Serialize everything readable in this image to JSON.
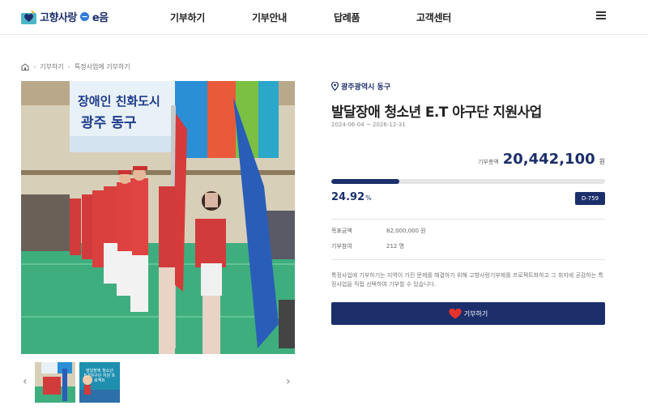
{
  "header": {
    "logo_text": "고향사랑",
    "logo_suffix": "e음",
    "nav": [
      "기부하기",
      "기부안내",
      "답례품",
      "고객센터"
    ]
  },
  "breadcrumb": [
    "기부하기",
    "특정사업에 기부하기"
  ],
  "photo": {
    "banner_line1": "장애인 친화도시",
    "banner_line2": "광주 동구"
  },
  "thumbnails": {
    "thumb2_text": "발달장애 청소년 E.T야구단 지원 프로젝트"
  },
  "project": {
    "region": "광주광역시 동구",
    "title": "발달장애 청소년 E.T 야구단 지원사업",
    "period": "2024-06-04 ~ 2026-12-31",
    "donate_total_label": "기부총액",
    "donate_total_value": "20,442,100",
    "donate_total_unit": "원",
    "percent": "24.92",
    "percent_unit": "%",
    "progress_fraction": 0.2492,
    "dday": "D-759",
    "target_label": "목표금액",
    "target_value": "82,000,000 원",
    "participants_label": "기부참여",
    "participants_value": "212 명",
    "description": "특정사업에 기부하기는 지역이 가진 문제를 해결하기 위해 고향사랑기부제를 프로젝트화하고 그 취지에 공감하는 특정사업을 직접 선택하여 기부할 수 있습니다.",
    "donate_button": "기부하기"
  },
  "colors": {
    "brand": "#1c2f6b",
    "progress_track": "#e5e5e5",
    "heart": "#e8332d"
  }
}
